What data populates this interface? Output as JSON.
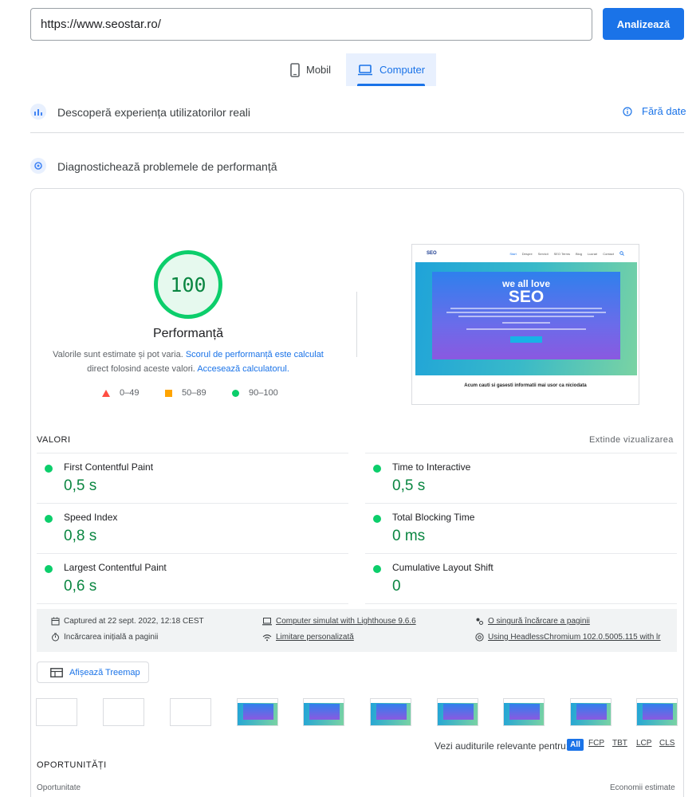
{
  "url_bar": {
    "value": "https://www.seostar.ro/",
    "analyze_label": "Analizează"
  },
  "device_tabs": {
    "mobile_label": "Mobil",
    "desktop_label": "Computer",
    "selected": "Computer"
  },
  "field_section": {
    "title": "Descoperă experiența utilizatorilor reali",
    "status": "Fără date"
  },
  "lab_section": {
    "title": "Diagnostichează problemele de performanță"
  },
  "performance": {
    "score": "100",
    "title": "Performanță",
    "desc_prefix": "Valorile sunt estimate și pot varia. ",
    "desc_link1": "Scorul de performanță este calculat",
    "desc_mid": "direct folosind aceste valori. ",
    "desc_link2": "Accesează calculatorul.",
    "legend": {
      "fail": "0–49",
      "average": "50–89",
      "pass": "90–100"
    },
    "colors": {
      "pass": "#0cce6b",
      "average": "#ffa400",
      "fail": "#ff4e42"
    }
  },
  "preview": {
    "logo": "SEO",
    "nav": [
      "Start",
      "Despre",
      "Servicii",
      "SEO Terms",
      "Blog",
      "Lucrari",
      "Contact"
    ],
    "hero_line1": "we all love",
    "hero_line2": "SEO",
    "caption": "Acum cauti si gasesti informatii mai usor ca niciodata"
  },
  "metrics_section": {
    "title": "VALORI",
    "expand_label": "Extinde vizualizarea",
    "metrics": [
      {
        "label": "First Contentful Paint",
        "value": "0,5 s"
      },
      {
        "label": "Time to Interactive",
        "value": "0,5 s"
      },
      {
        "label": "Speed Index",
        "value": "0,8 s"
      },
      {
        "label": "Total Blocking Time",
        "value": "0 ms"
      },
      {
        "label": "Largest Contentful Paint",
        "value": "0,6 s"
      },
      {
        "label": "Cumulative Layout Shift",
        "value": "0"
      }
    ]
  },
  "run_info": {
    "captured": "Captured at 22 sept. 2022, 12:18 CEST",
    "initial_load": "Încărcarea inițială a paginii",
    "device": "Computer simulat with Lighthouse 9.6.6",
    "throttling": "Limitare personalizată",
    "single_load": "O singură încărcare a paginii",
    "browser": "Using HeadlessChromium 102.0.5005.115 with lr"
  },
  "treemap_label": "Afișează Treemap",
  "audit_filter": {
    "label": "Vezi auditurile relevante pentru:",
    "chips": [
      "All",
      "FCP",
      "TBT",
      "LCP",
      "CLS"
    ],
    "selected": "All"
  },
  "opportunities": {
    "title": "OPORTUNITĂȚI",
    "col_left": "Oportunitate",
    "col_right": "Economii estimate"
  }
}
